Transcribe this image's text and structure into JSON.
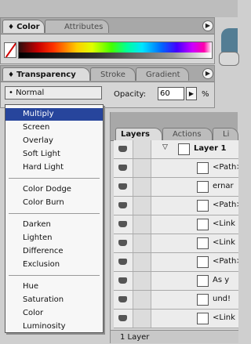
{
  "color_panel": {
    "tabs": [
      {
        "label": "Color",
        "active": true
      },
      {
        "label": "Attributes",
        "active": false
      }
    ],
    "menu_glyph": "▶"
  },
  "transparency_panel": {
    "tabs": [
      {
        "label": "Transparency",
        "active": true
      },
      {
        "label": "Stroke",
        "active": false
      },
      {
        "label": "Gradient",
        "active": false
      }
    ],
    "menu_glyph": "▶",
    "blend_mode": "Normal",
    "opacity_label": "Opacity:",
    "opacity_value": "60",
    "opacity_unit": "%",
    "arrow_glyph": "▶"
  },
  "blend_menu": {
    "items": [
      "Multiply",
      "Screen",
      "Overlay",
      "Soft Light",
      "Hard Light",
      "Color Dodge",
      "Color Burn",
      "Darken",
      "Lighten",
      "Difference",
      "Exclusion",
      "Hue",
      "Saturation",
      "Color",
      "Luminosity"
    ],
    "selected": "Multiply"
  },
  "layers_panel": {
    "tabs": [
      {
        "label": "Layers",
        "active": true
      },
      {
        "label": "Actions",
        "active": false
      },
      {
        "label": "Li",
        "active": false
      }
    ],
    "rows": [
      {
        "name": "Layer 1",
        "top_level": true
      },
      {
        "name": "<Path>",
        "top_level": false
      },
      {
        "name": "ernar",
        "top_level": false
      },
      {
        "name": "<Path>",
        "top_level": false
      },
      {
        "name": "<Link",
        "top_level": false
      },
      {
        "name": "<Link",
        "top_level": false
      },
      {
        "name": "<Path>",
        "top_level": false
      },
      {
        "name": "As y",
        "top_level": false
      },
      {
        "name": "und!",
        "top_level": false
      },
      {
        "name": "<Link",
        "top_level": false
      }
    ],
    "status": "1 Layer"
  },
  "colors": {
    "selection": "#27459c",
    "panel_bg": "#d6d6d6"
  }
}
